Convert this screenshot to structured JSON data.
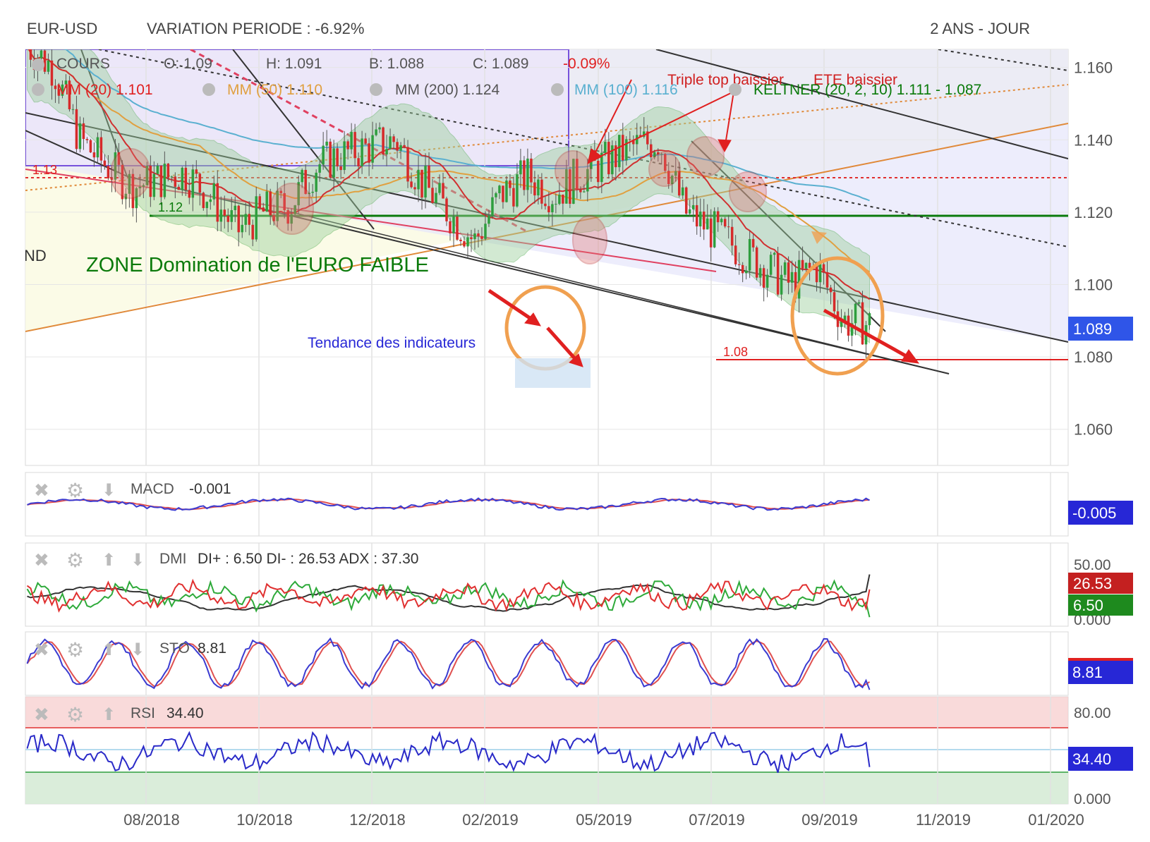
{
  "header": {
    "symbol": "EUR-USD",
    "variation": "VARIATION PERIODE : -6.92%",
    "period": "2 ANS - JOUR"
  },
  "colors": {
    "up_candle": "#2e9e3e",
    "down_candle": "#d62a2a",
    "macd_line": "#3b3bd1",
    "signal_line": "#e05050",
    "di_plus": "#2eaa3a",
    "di_minus": "#e03030",
    "adx": "#333333",
    "rsi_line": "#2a2ac8",
    "accent_blue": "#2727d6",
    "accent_green": "#0a7a0a",
    "accent_orange": "#f0a050",
    "accent_red": "#e02020"
  },
  "main_panel": {
    "ohlc": {
      "cours": "COURS",
      "open": "O: 1.09",
      "high": "H: 1.091",
      "low": "B: 1.088",
      "close": "C: 1.089",
      "change": "-0.09%"
    },
    "indicators": {
      "mm20": "MM (20) 1.101",
      "mm50": "MM (50) 1.110",
      "mm200": "MM (200) 1.124",
      "mm100": "MM (100) 1.116",
      "keltner": "KELTNER (20, 2, 10)  1.111 - 1.087"
    },
    "annotations": {
      "zone": "ZONE Domination de l'EURO FAIBLE",
      "tendance": "Tendance des indicateurs",
      "triple_top": "Triple top baissier",
      "ete": "ETE baissier",
      "level_113": "1.13",
      "level_112": "1.12",
      "level_108": "1.08",
      "edge_text": "ND"
    },
    "price_axis": [
      "1.160",
      "1.140",
      "1.120",
      "1.100",
      "1.080",
      "1.060"
    ],
    "last_price": "1.089"
  },
  "macd_panel": {
    "label": "MACD",
    "value": "-0.001",
    "badge": "-0.005"
  },
  "dmi_panel": {
    "label": "DMI",
    "values": "DI+ : 6.50 DI- : 26.53 ADX : 37.30",
    "axis_top": "50.00",
    "axis_bottom": "0.000",
    "di_minus_badge": "26.53",
    "di_plus_badge": "6.50"
  },
  "sto_panel": {
    "label": "STO",
    "value": "8.81",
    "badge": "8.81"
  },
  "rsi_panel": {
    "label": "RSI",
    "value": "34.40",
    "badge": "34.40",
    "axis_top": "80.00",
    "axis_bottom": "0.000"
  },
  "x_axis": [
    "08/2018",
    "10/2018",
    "12/2018",
    "02/2019",
    "05/2019",
    "07/2019",
    "09/2019",
    "11/2019",
    "01/2020"
  ],
  "chart_data": {
    "type": "line",
    "title": "EUR-USD",
    "subtitle": "VARIATION PERIODE : -6.92%",
    "period": "2 ANS - JOUR",
    "ylim": [
      1.05,
      1.165
    ],
    "xlabel": "",
    "ylabel": "",
    "x": [
      "08/2018",
      "10/2018",
      "12/2018",
      "02/2019",
      "05/2019",
      "07/2019",
      "09/2019"
    ],
    "series": [
      {
        "name": "COURS",
        "values": [
          1.166,
          1.16,
          1.14,
          1.133,
          1.127,
          1.129,
          1.131,
          1.124,
          1.115,
          1.12,
          1.122,
          1.133,
          1.136,
          1.138,
          1.14,
          1.128,
          1.12,
          1.112,
          1.125,
          1.13,
          1.125,
          1.13,
          1.134,
          1.138,
          1.14,
          1.12,
          1.115,
          1.11,
          1.105,
          1.1,
          1.105,
          1.09,
          1.089
        ]
      }
    ],
    "levels": [
      1.13,
      1.12,
      1.08
    ],
    "indicators": {
      "MACD": -0.001,
      "DI+": 6.5,
      "DI-": 26.53,
      "ADX": 37.3,
      "STO": 8.81,
      "RSI": 34.4
    }
  }
}
